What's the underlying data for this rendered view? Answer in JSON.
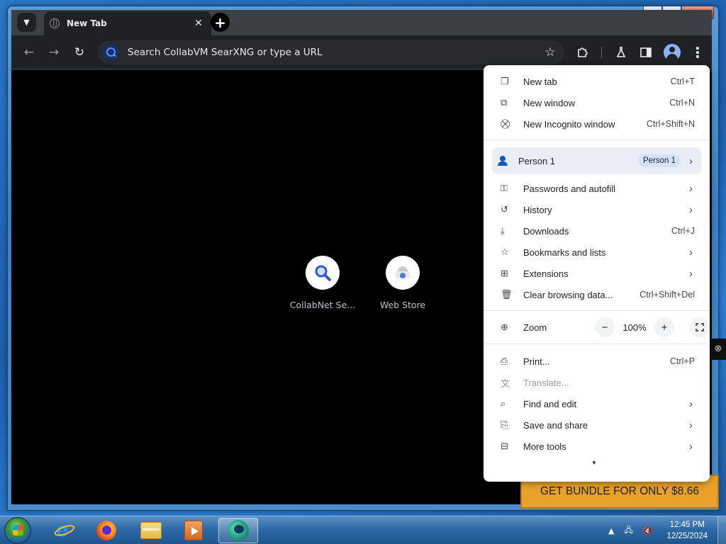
{
  "browser": {
    "tab": {
      "title": "New Tab",
      "close_glyph": "✕"
    },
    "new_tab_glyph": "+",
    "omnibox": {
      "placeholder": "Search CollabVM SearXNG or type a URL"
    },
    "shortcuts": [
      {
        "title": "CollabNet Se...",
        "icon": "search-icon"
      },
      {
        "title": "Web Store",
        "icon": "web-store-icon"
      }
    ]
  },
  "menu": {
    "group1": [
      {
        "label": "New tab",
        "shortcut": "Ctrl+T",
        "icon": "new-tab-icon"
      },
      {
        "label": "New window",
        "shortcut": "Ctrl+N",
        "icon": "new-window-icon"
      },
      {
        "label": "New Incognito window",
        "shortcut": "Ctrl+Shift+N",
        "icon": "incognito-icon"
      }
    ],
    "person": {
      "label": "Person 1",
      "badge": "Person 1"
    },
    "group2": [
      {
        "label": "Passwords and autofill",
        "icon": "key-icon",
        "submenu": true
      },
      {
        "label": "History",
        "icon": "history-icon",
        "submenu": true
      },
      {
        "label": "Downloads",
        "shortcut": "Ctrl+J",
        "icon": "download-icon"
      },
      {
        "label": "Bookmarks and lists",
        "icon": "star-icon",
        "submenu": true
      },
      {
        "label": "Extensions",
        "icon": "puzzle-icon",
        "submenu": true
      },
      {
        "label": "Clear browsing data...",
        "shortcut": "Ctrl+Shift+Del",
        "icon": "trash-icon"
      }
    ],
    "zoom": {
      "label": "Zoom",
      "value": "100%",
      "minus": "−",
      "plus": "+"
    },
    "group3": [
      {
        "label": "Print...",
        "shortcut": "Ctrl+P",
        "icon": "print-icon"
      },
      {
        "label": "Translate...",
        "icon": "translate-icon",
        "disabled": true
      },
      {
        "label": "Find and edit",
        "icon": "find-icon",
        "submenu": true
      },
      {
        "label": "Save and share",
        "icon": "save-icon",
        "submenu": true
      },
      {
        "label": "More tools",
        "icon": "toolbox-icon",
        "submenu": true
      }
    ]
  },
  "ad": {
    "text": "GET BUNDLE FOR ONLY $8.66"
  },
  "taskbar": {
    "clock": {
      "time": "12:45 PM",
      "date": "12/25/2024"
    }
  }
}
